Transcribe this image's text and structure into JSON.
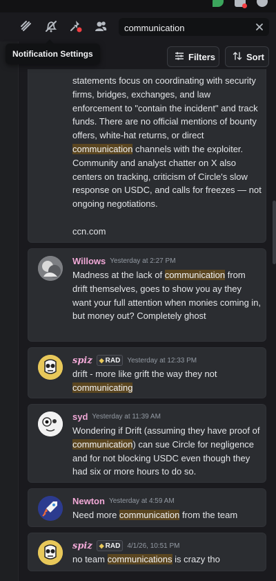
{
  "toolbar": {
    "search": {
      "value": "communication",
      "placeholder": "Search"
    },
    "tooltip": "Notification Settings",
    "filters_label": "Filters",
    "sort_label": "Sort"
  },
  "results": [
    {
      "continued": true,
      "segments": [
        {
          "t": "statements focus on coordinating with security firms, bridges, exchanges, and law enforcement to \"contain the incident\" and track funds. There are no official mentions of bounty offers, white-hat returns, or direct ",
          "h": false
        },
        {
          "t": "communication",
          "h": true
        },
        {
          "t": " channels with the exploiter. Community and analyst chatter on X also centers on tracking, criticism of Circle's slow response on USDC, and calls for freezes — not ongoing negotiations.",
          "h": false
        }
      ],
      "footer": "ccn.com"
    },
    {
      "author": "Willows",
      "author_color": "#f0a8d6",
      "timestamp": "Yesterday at 2:27 PM",
      "tag": "",
      "segments": [
        {
          "t": "Madness at the lack of ",
          "h": false
        },
        {
          "t": "communication",
          "h": true
        },
        {
          "t": " from drift themselves, goes to show you ay they want your full attention when monies coming in, but money out? Completely ghost",
          "h": false
        }
      ]
    },
    {
      "author": "spiz",
      "author_color": "#f0a8d6",
      "timestamp": "Yesterday at 12:33 PM",
      "tag": "RAD",
      "segments": [
        {
          "t": "drift - more like grift the way they not ",
          "h": false
        },
        {
          "t": "communicating",
          "h": true
        }
      ]
    },
    {
      "author": "syd",
      "author_color": "#f0a8d6",
      "timestamp": "Yesterday at 11:39 AM",
      "tag": "",
      "segments": [
        {
          "t": "Wondering if Drift (assuming they have proof of ",
          "h": false
        },
        {
          "t": "communication",
          "h": true
        },
        {
          "t": ") can sue Circle for negligence and for not blocking USDC even though they had six or more hours to do so.",
          "h": false
        }
      ]
    },
    {
      "author": "Newton",
      "author_color": "#f0a8d6",
      "timestamp": "Yesterday at 4:59 AM",
      "tag": "",
      "segments": [
        {
          "t": "Need more ",
          "h": false
        },
        {
          "t": "communication",
          "h": true
        },
        {
          "t": " from the team",
          "h": false
        }
      ]
    },
    {
      "author": "spiz",
      "author_color": "#f0a8d6",
      "timestamp": "4/1/26, 10:51 PM",
      "tag": "RAD",
      "segments": [
        {
          "t": "no team ",
          "h": false
        },
        {
          "t": "communications",
          "h": true
        },
        {
          "t": " is crazy tho",
          "h": false
        }
      ]
    }
  ],
  "icons": {
    "threads": "threads-icon",
    "notifications_muted": "bell-slash-icon",
    "pinned": "pin-icon",
    "members": "members-icon",
    "clear": "close-icon",
    "filters": "sliders-icon",
    "sort": "sort-arrows-icon"
  },
  "colors": {
    "background": "#1a1a1e",
    "card": "#2b2d31",
    "highlight": "#5b4620",
    "author": "#f0a8d6",
    "timestamp": "#949ba4"
  }
}
